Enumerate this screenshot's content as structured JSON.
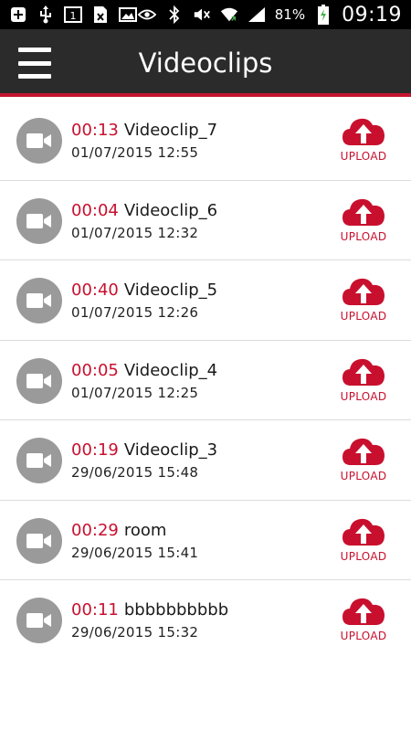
{
  "status_bar": {
    "battery_percent": "81%",
    "time": "09:19",
    "left_icons": [
      "add-icon",
      "usb-icon",
      "calendar-icon",
      "sim-off-icon",
      "image-icon"
    ],
    "right_icons": [
      "eye-icon",
      "bluetooth-icon",
      "mute-icon",
      "wifi-icon",
      "signal-icon",
      "battery-charging-icon"
    ],
    "calendar_day": "1"
  },
  "app_bar": {
    "title": "Videoclips",
    "menu_icon": "hamburger-menu-icon"
  },
  "colors": {
    "accent": "#c8102e",
    "app_bar": "#2b2b2b",
    "icon_gray": "#9a9a9a"
  },
  "clips": [
    {
      "duration": "00:13",
      "name": "Videoclip_7",
      "date": "01/07/2015 12:55",
      "upload_label": "UPLOAD"
    },
    {
      "duration": "00:04",
      "name": "Videoclip_6",
      "date": "01/07/2015 12:32",
      "upload_label": "UPLOAD"
    },
    {
      "duration": "00:40",
      "name": "Videoclip_5",
      "date": "01/07/2015 12:26",
      "upload_label": "UPLOAD"
    },
    {
      "duration": "00:05",
      "name": "Videoclip_4",
      "date": "01/07/2015 12:25",
      "upload_label": "UPLOAD"
    },
    {
      "duration": "00:19",
      "name": "Videoclip_3",
      "date": "29/06/2015 15:48",
      "upload_label": "UPLOAD"
    },
    {
      "duration": "00:29",
      "name": "room",
      "date": "29/06/2015 15:41",
      "upload_label": "UPLOAD"
    },
    {
      "duration": "00:11",
      "name": "bbbbbbbbbb",
      "date": "29/06/2015 15:32",
      "upload_label": "UPLOAD"
    }
  ]
}
